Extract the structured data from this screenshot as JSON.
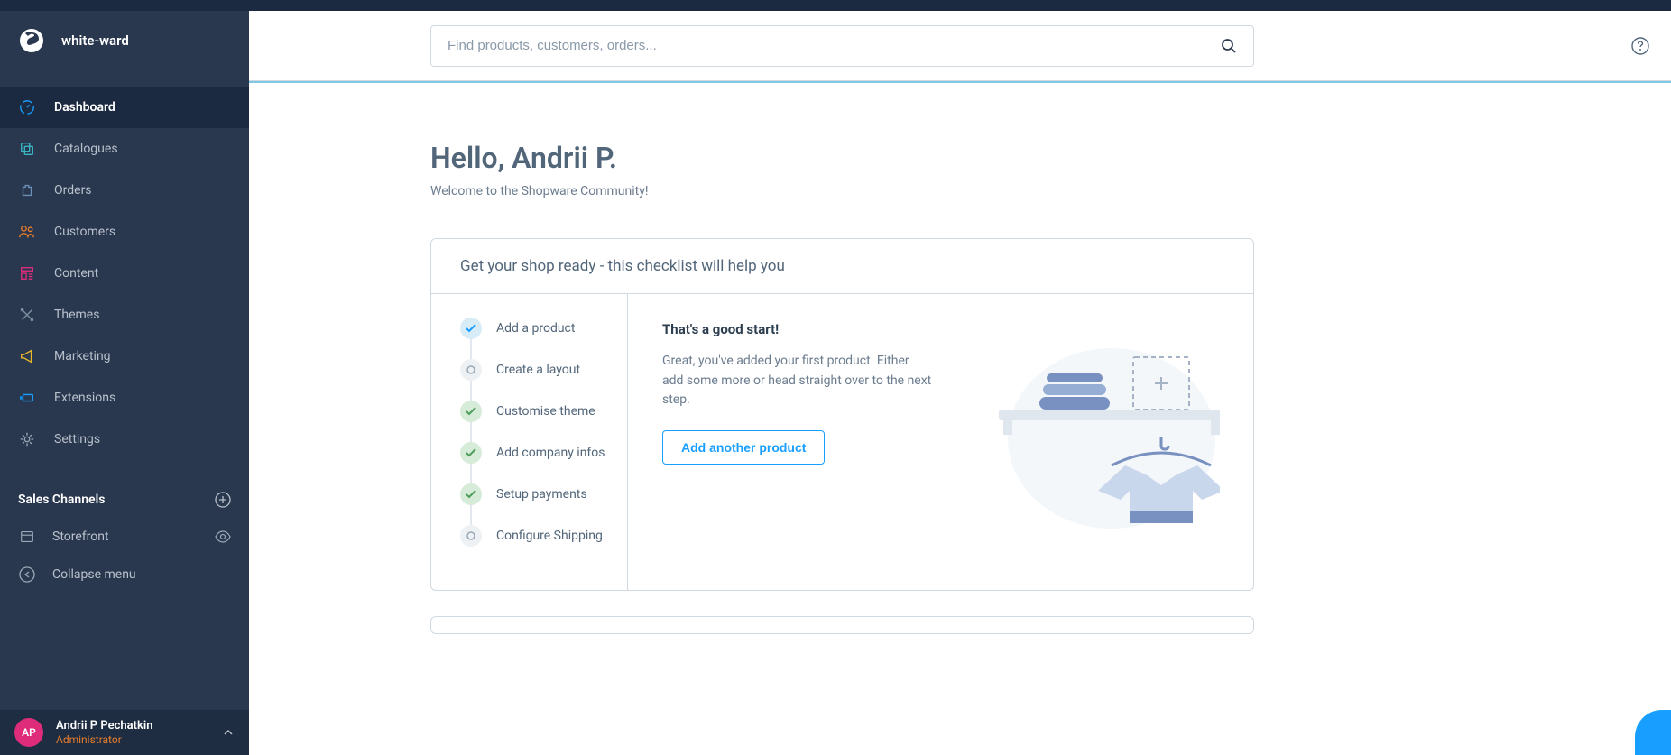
{
  "brand": {
    "name": "white-ward"
  },
  "nav": {
    "items": [
      {
        "label": "Dashboard",
        "icon": "dashboard",
        "active": true
      },
      {
        "label": "Catalogues",
        "icon": "catalogues",
        "active": false
      },
      {
        "label": "Orders",
        "icon": "orders",
        "active": false
      },
      {
        "label": "Customers",
        "icon": "customers",
        "active": false
      },
      {
        "label": "Content",
        "icon": "content",
        "active": false
      },
      {
        "label": "Themes",
        "icon": "themes",
        "active": false
      },
      {
        "label": "Marketing",
        "icon": "marketing",
        "active": false
      },
      {
        "label": "Extensions",
        "icon": "extensions",
        "active": false
      },
      {
        "label": "Settings",
        "icon": "settings",
        "active": false
      }
    ]
  },
  "channels": {
    "header": "Sales Channels",
    "items": [
      {
        "label": "Storefront"
      }
    ],
    "collapse": "Collapse menu"
  },
  "user": {
    "initials": "AP",
    "name": "Andrii P Pechatkin",
    "role": "Administrator"
  },
  "search": {
    "placeholder": "Find products, customers, orders..."
  },
  "dashboard": {
    "greeting": "Hello, Andrii P.",
    "subtitle": "Welcome to the Shopware Community!",
    "checklist_title": "Get your shop ready - this checklist will help you",
    "steps": [
      {
        "label": "Add a product",
        "state": "active"
      },
      {
        "label": "Create a layout",
        "state": "pending"
      },
      {
        "label": "Customise theme",
        "state": "done"
      },
      {
        "label": "Add company infos",
        "state": "done"
      },
      {
        "label": "Setup payments",
        "state": "done"
      },
      {
        "label": "Configure Shipping",
        "state": "pending"
      }
    ],
    "detail": {
      "title": "That's a good start!",
      "description": "Great, you've added your first product. Either add some more or head straight over to the next step.",
      "button": "Add another product"
    }
  }
}
